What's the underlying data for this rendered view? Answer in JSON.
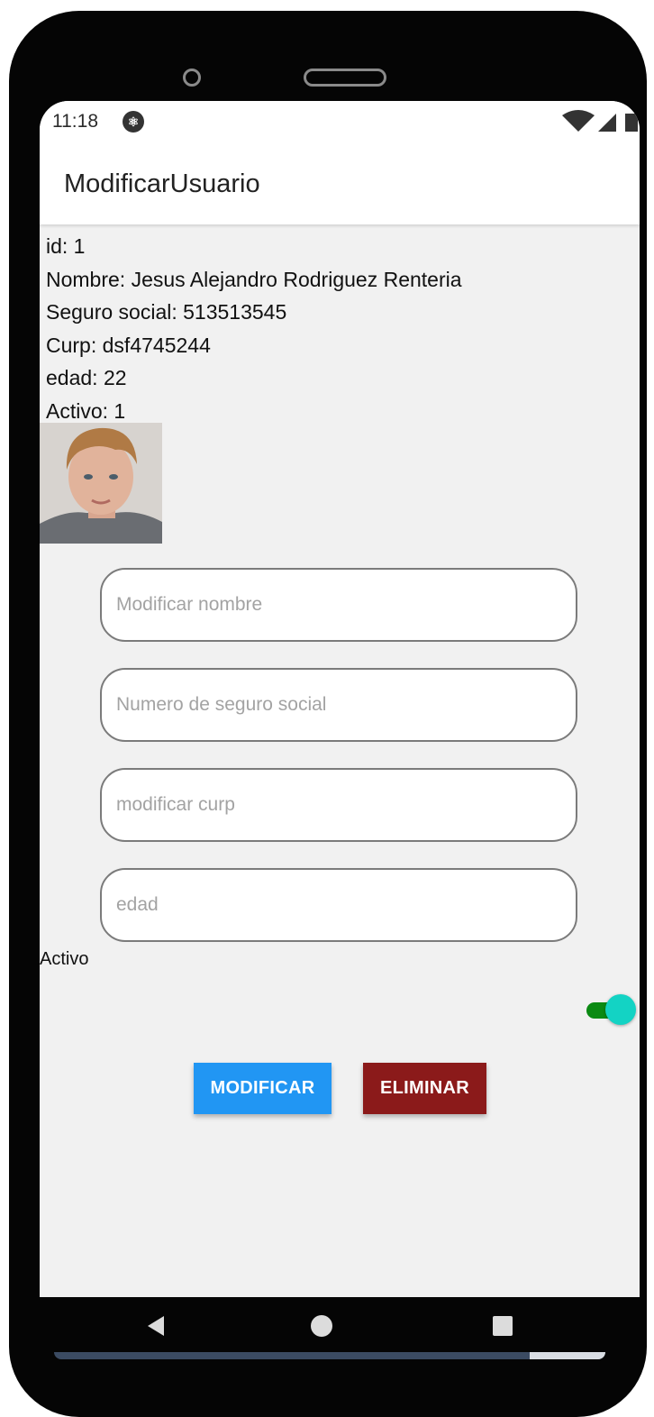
{
  "status_bar": {
    "time": "11:18",
    "app_icon": "react-native-icon"
  },
  "app_bar": {
    "title": "ModificarUsuario"
  },
  "user_info": {
    "id": "id: 1",
    "nombre": "Nombre: Jesus Alejandro Rodriguez Renteria",
    "seguro_social": "Seguro social: 513513545",
    "curp": "Curp: dsf4745244",
    "edad": "edad: 22",
    "activo": "Activo: 1"
  },
  "form": {
    "nombre_placeholder": "Modificar nombre",
    "seguro_placeholder": "Numero de seguro social",
    "curp_placeholder": "modificar curp",
    "edad_placeholder": "edad",
    "activo_label": "Activo",
    "activo_toggle_on": true
  },
  "actions": {
    "modify_label": "MODIFICAR",
    "delete_label": "ELIMINAR"
  },
  "colors": {
    "modify_button": "#2196f3",
    "delete_button": "#8b1a1a",
    "toggle_track": "#0b8a13",
    "toggle_thumb": "#13d3c4"
  },
  "nav_bar": {
    "back_icon": "triangle-back-icon",
    "home_icon": "circle-home-icon",
    "recent_icon": "square-recent-icon"
  }
}
